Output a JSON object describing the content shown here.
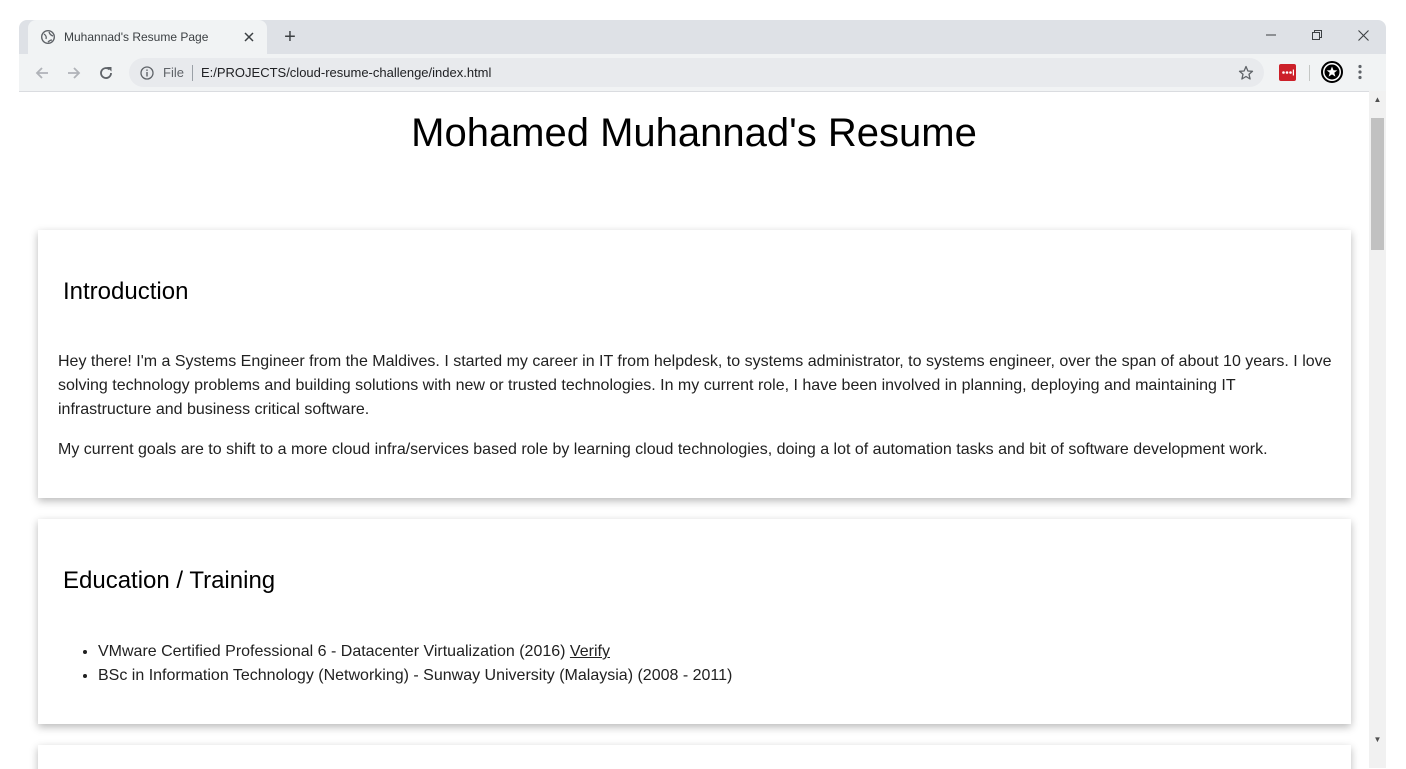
{
  "browser": {
    "tab_title": "Muhannad's Resume Page",
    "new_tab": "+",
    "scheme_label": "File",
    "url": "E:/PROJECTS/cloud-resume-challenge/index.html"
  },
  "page": {
    "title": "Mohamed Muhannad's Resume",
    "introduction": {
      "heading": "Introduction",
      "paragraph1": "Hey there! I'm a Systems Engineer from the Maldives. I started my career in IT from helpdesk, to systems administrator, to systems engineer, over the span of about 10 years. I love solving technology problems and building solutions with new or trusted technologies. In my current role, I have been involved in planning, deploying and maintaining IT infrastructure and business critical software.",
      "paragraph2": "My current goals are to shift to a more cloud infra/services based role by learning cloud technologies, doing a lot of automation tasks and bit of software development work."
    },
    "education": {
      "heading": "Education / Training",
      "items": [
        {
          "text": "VMware Certified Professional 6 - Datacenter Virtualization (2016) ",
          "link": "Verify"
        },
        {
          "text": "BSc in Information Technology (Networking) - Sunway University (Malaysia) (2008 - 2011)"
        }
      ]
    }
  },
  "icons": {
    "favicon": "globe-icon",
    "close": "close-icon",
    "back": "back-arrow-icon",
    "forward": "forward-arrow-icon",
    "reload": "reload-icon",
    "info": "info-icon",
    "star": "star-icon",
    "extension1": "lastpass-icon",
    "extension2": "star-badge-icon",
    "menu": "kebab-menu-icon"
  },
  "colors": {
    "tabstrip": "#dee1e6",
    "toolbar": "#f1f3f4",
    "extension_red": "#cc2029"
  }
}
